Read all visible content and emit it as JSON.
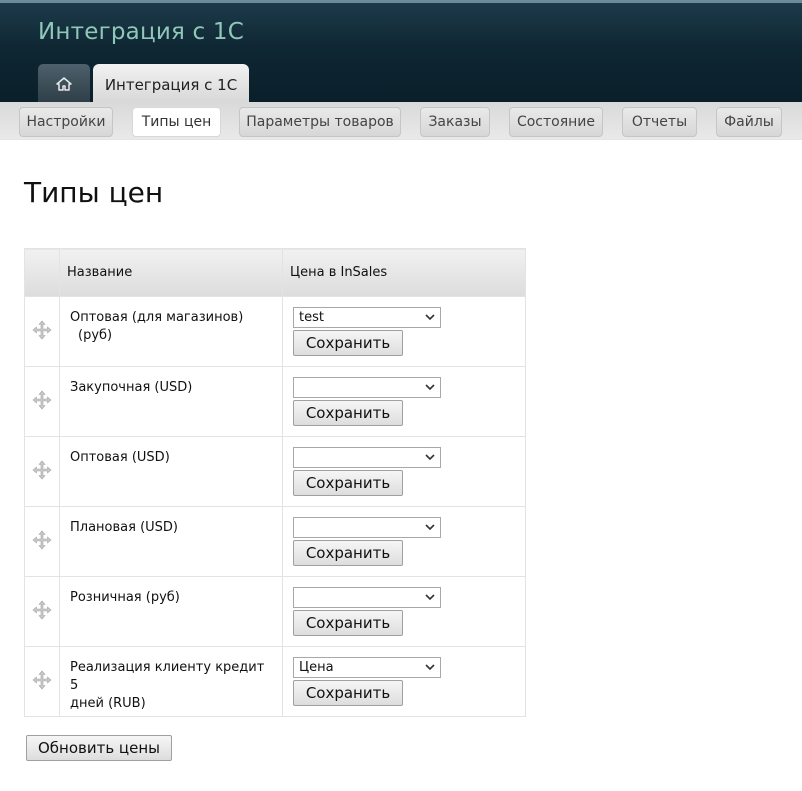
{
  "app": {
    "title": "Интеграция с 1С"
  },
  "top_tabs": {
    "home_icon": "home-icon",
    "active_label": "Интеграция с 1С"
  },
  "subnav": {
    "items": [
      {
        "label": "Настройки"
      },
      {
        "label": "Типы цен"
      },
      {
        "label": "Параметры товаров"
      },
      {
        "label": "Заказы"
      },
      {
        "label": "Состояние"
      },
      {
        "label": "Отчеты"
      },
      {
        "label": "Файлы"
      }
    ],
    "active": "Типы цен"
  },
  "page": {
    "title": "Типы цен"
  },
  "table": {
    "headers": {
      "name": "Название",
      "price": "Цена в InSales"
    },
    "save_label": "Сохранить",
    "rows": [
      {
        "name_line1": "Оптовая (для магазинов)",
        "name_line2": "(руб)",
        "selected": "test"
      },
      {
        "name_line1": "Закупочная   (USD)",
        "name_line2": "",
        "selected": ""
      },
      {
        "name_line1": "Оптовая   (USD)",
        "name_line2": "",
        "selected": ""
      },
      {
        "name_line1": "Плановая   (USD)",
        "name_line2": "",
        "selected": ""
      },
      {
        "name_line1": "Розничная   (руб)",
        "name_line2": "",
        "selected": ""
      },
      {
        "name_line1": "Реализация клиенту кредит 5",
        "name_line2": "дней   (RUB)",
        "selected": "Цена"
      }
    ]
  },
  "refresh_button": {
    "label": "Обновить цены"
  },
  "colors": {
    "header_bg": "#0f2733",
    "title_text": "#8fc7b8"
  }
}
